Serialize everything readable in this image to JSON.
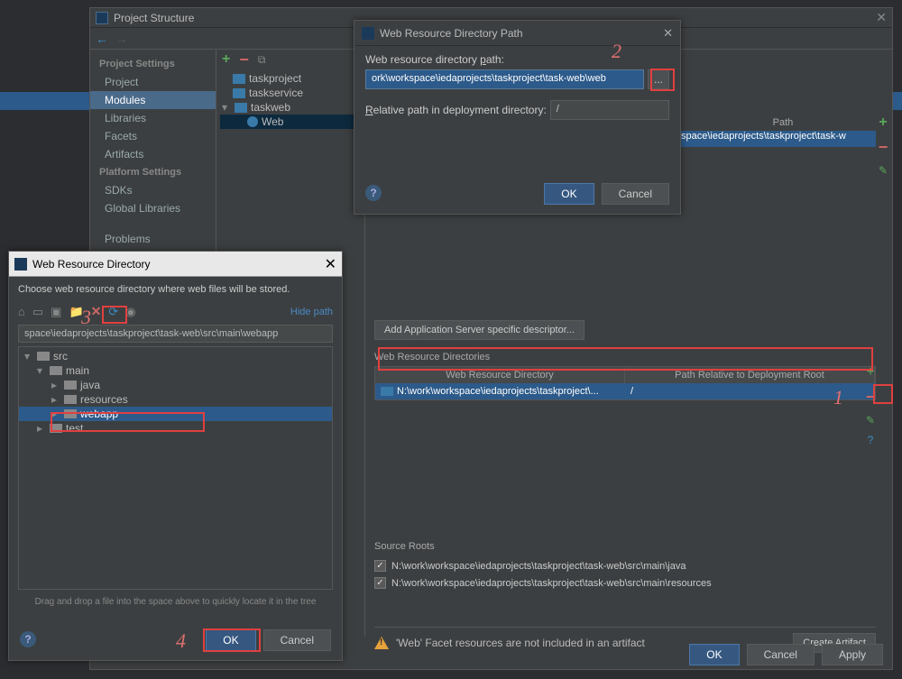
{
  "ps": {
    "title": "Project Structure",
    "sidebar": {
      "grp1": "Project Settings",
      "items1": [
        "Project",
        "Modules",
        "Libraries",
        "Facets",
        "Artifacts"
      ],
      "grp2": "Platform Settings",
      "items2": [
        "SDKs",
        "Global Libraries"
      ],
      "problems": "Problems"
    },
    "modules": {
      "m0": "taskproject",
      "m1": "taskservice",
      "m2": "taskweb",
      "m3": "Web"
    },
    "dep_cols": {
      "c1": "Path"
    },
    "dep_row": "space\\iedaprojects\\taskproject\\task-w",
    "add_desc": "Add Application Server specific descriptor...",
    "wrd_label": "Web Resource Directories",
    "wrd_cols": {
      "c1": "Web Resource Directory",
      "c2": "Path Relative to Deployment Root"
    },
    "wrd_row": {
      "c1": "N:\\work\\workspace\\iedaprojects\\taskproject\\...",
      "c2": "/"
    },
    "source_roots_label": "Source Roots",
    "sr1": "N:\\work\\workspace\\iedaprojects\\taskproject\\task-web\\src\\main\\java",
    "sr2": "N:\\work\\workspace\\iedaprojects\\taskproject\\task-web\\src\\main\\resources",
    "warn": "'Web' Facet resources are not included in an artifact",
    "create_artifact": "Create Artifact",
    "ok": "OK",
    "cancel": "Cancel",
    "apply": "Apply"
  },
  "wrdp": {
    "title": "Web Resource Directory Path",
    "lbl1": "Web resource directory path:",
    "path": "ork\\workspace\\iedaprojects\\taskproject\\task-web\\web",
    "browse": "...",
    "lbl2": "Relative path in deployment directory:",
    "rel": "/",
    "ok": "OK",
    "cancel": "Cancel"
  },
  "wrd": {
    "title": "Web Resource Directory",
    "subtitle": "Choose web resource directory where web files will be stored.",
    "hide_path": "Hide path",
    "path": "space\\iedaprojects\\taskproject\\task-web\\src\\main\\webapp",
    "tree": {
      "src": "src",
      "main": "main",
      "java": "java",
      "resources": "resources",
      "webapp": "webapp",
      "test": "test"
    },
    "hint": "Drag and drop a file into the space above to quickly locate it in the tree",
    "ok": "OK",
    "cancel": "Cancel"
  },
  "annotations": {
    "n1": "1",
    "n2": "2",
    "n3": "3",
    "n4": "4"
  }
}
